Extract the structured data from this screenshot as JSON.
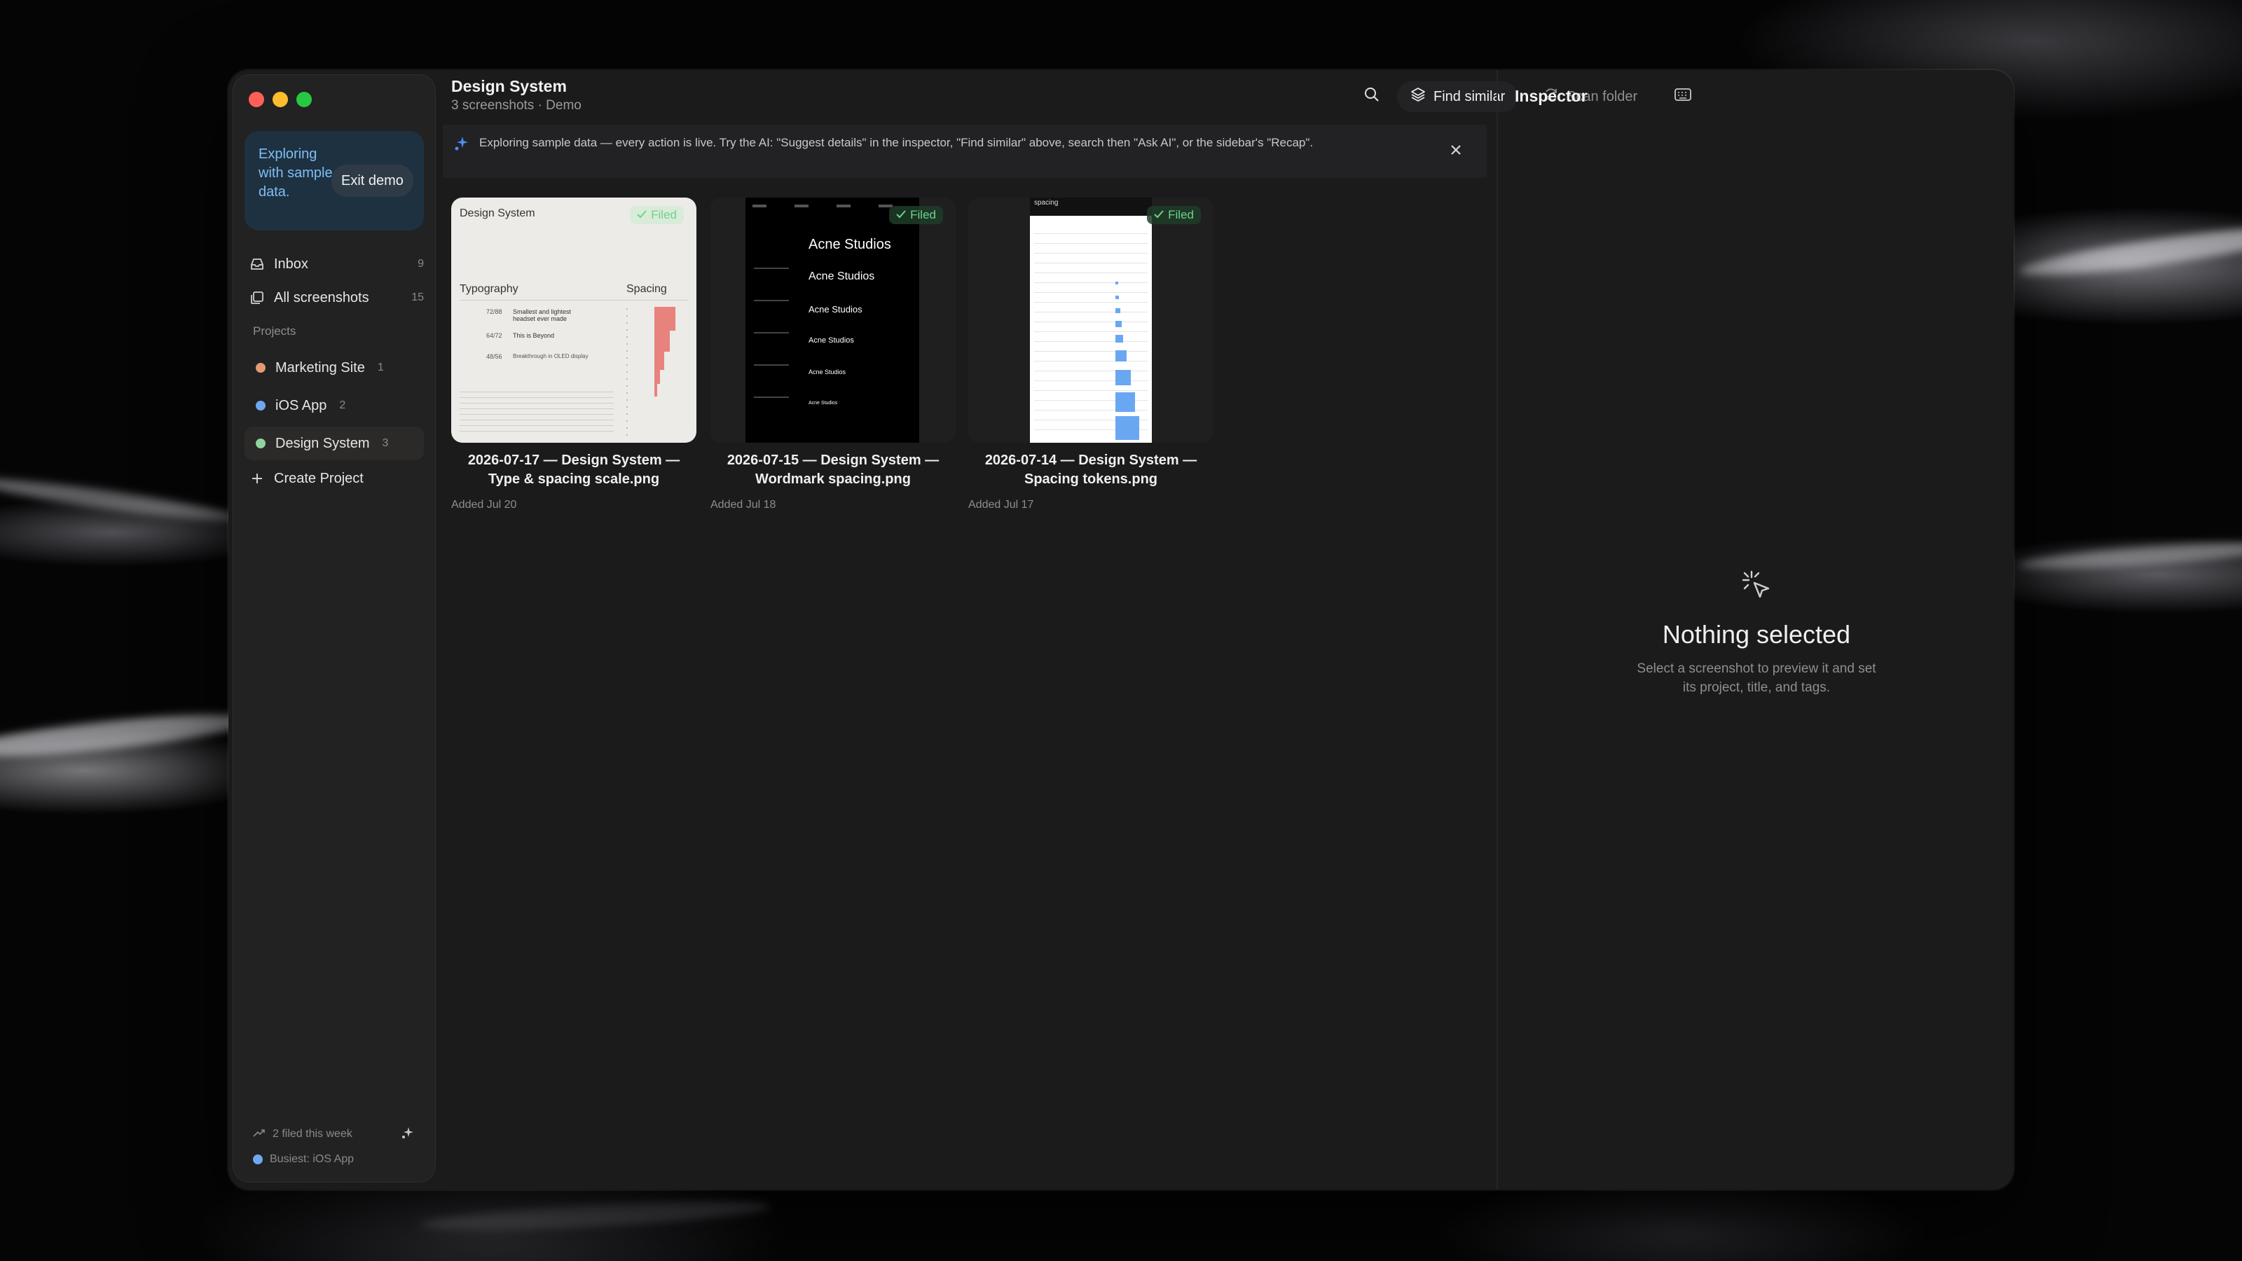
{
  "sidebar": {
    "demo": {
      "message": "Exploring with sample data.",
      "exit_label": "Exit demo"
    },
    "nav": [
      {
        "label": "Inbox",
        "count": "9",
        "icon": "inbox-icon"
      },
      {
        "label": "All screenshots",
        "count": "15",
        "icon": "stack-icon"
      }
    ],
    "projects_label": "Projects",
    "projects": [
      {
        "name": "Marketing Site",
        "count": "1",
        "color": "#e39a72"
      },
      {
        "name": "iOS App",
        "count": "2",
        "color": "#6fa8f0"
      },
      {
        "name": "Design System",
        "count": "3",
        "color": "#8fd3a0"
      }
    ],
    "create_label": "Create Project",
    "footer": {
      "filed": "2 filed this week",
      "busiest": "Busiest: iOS App",
      "busiest_color": "#6fa8f0"
    }
  },
  "header": {
    "title": "Design System",
    "subtitle": "3 screenshots · Demo",
    "find_similar": "Find similar",
    "scan_folder": "Scan folder"
  },
  "banner": {
    "text": "Exploring sample data — every action is live. Try the AI: \"Suggest details\" in the inspector, \"Find similar\" above, search then \"Ask AI\", or the sidebar's \"Recap\"."
  },
  "cards": [
    {
      "caption": "2026-07-17 — Design System — Type & spacing scale.png",
      "added": "Added Jul 20",
      "badge": "Filed",
      "thumb": {
        "title": "Design System",
        "col_a": "Typography",
        "col_b": "Spacing",
        "rows": [
          "72/88",
          "64/72",
          "48/56"
        ],
        "row_text": [
          "Smallest and lightest headset ever made",
          "This is Beyond",
          "Breakthrough in OLED display"
        ]
      }
    },
    {
      "caption": "2026-07-15 — Design System — Wordmark spacing.png",
      "added": "Added Jul 18",
      "badge": "Filed",
      "thumb": {
        "wordmarks": [
          "Acne Studios",
          "Acne Studios",
          "Acne Studios",
          "Acne Studios",
          "Acne Studios",
          "Acne Studios"
        ]
      }
    },
    {
      "caption": "2026-07-14 — Design System — Spacing tokens.png",
      "added": "Added Jul 17",
      "badge": "Filed",
      "thumb": {
        "title": "spacing"
      }
    }
  ],
  "inspector": {
    "title": "Inspector",
    "empty_title": "Nothing selected",
    "empty_sub": "Select a screenshot to preview it and set its project, title, and tags."
  },
  "colors": {
    "accent": "#7fbef5",
    "filed": "#6fd38a",
    "close": "#ff5f57",
    "minimize": "#febc2e",
    "zoom": "#28c840"
  }
}
